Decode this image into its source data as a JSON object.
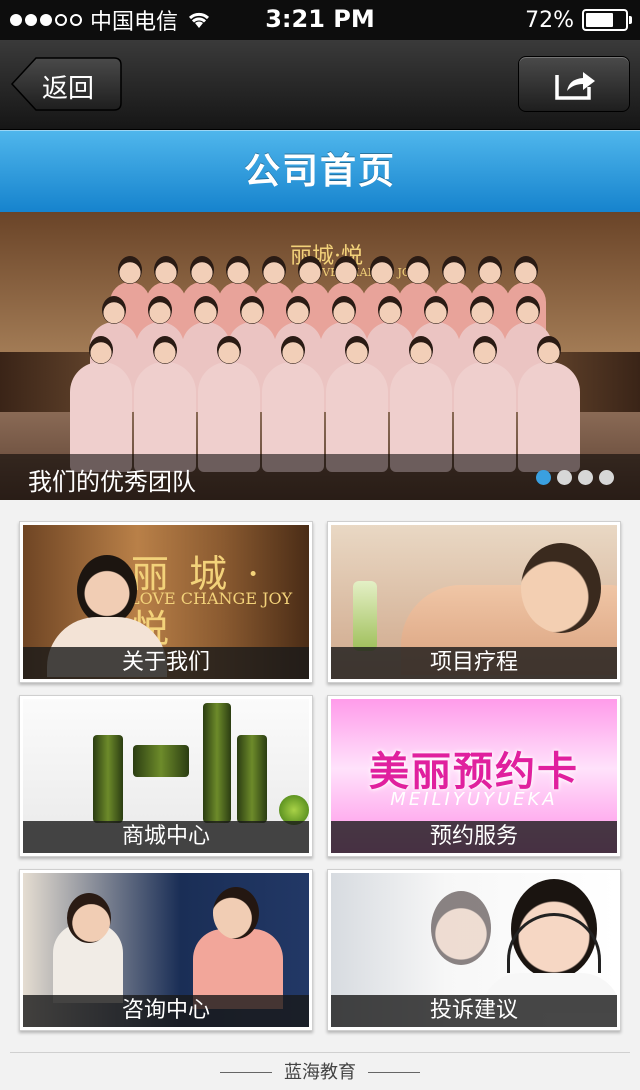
{
  "status_bar": {
    "carrier": "中国电信",
    "signal_filled": 3,
    "signal_total": 5,
    "time": "3:21 PM",
    "battery_text": "72%",
    "battery_level": 0.72
  },
  "nav": {
    "back_label": "返回",
    "share_icon": "share-icon"
  },
  "title": "公司首页",
  "hero": {
    "caption": "我们的优秀团队",
    "sign_text": "丽城·悦",
    "sign_en": "LOVE CHANGE JOY",
    "slides_total": 4,
    "active_slide": 1
  },
  "tiles": [
    {
      "label": "关于我们",
      "sign_cn": "丽 城 · 悦",
      "sign_en": "LOVE CHANGE JOY"
    },
    {
      "label": "项目疗程"
    },
    {
      "label": "商城中心"
    },
    {
      "label": "预约服务",
      "card_cn": "美丽预约卡",
      "card_en": "MEILIYUYUEKA"
    },
    {
      "label": "咨询中心"
    },
    {
      "label": "投诉建议"
    }
  ],
  "footer": "蓝海教育",
  "colors": {
    "title_blue": "#1e8fd6",
    "active_dot": "#3aa0e0",
    "nav_dark": "#1e1e1e"
  }
}
